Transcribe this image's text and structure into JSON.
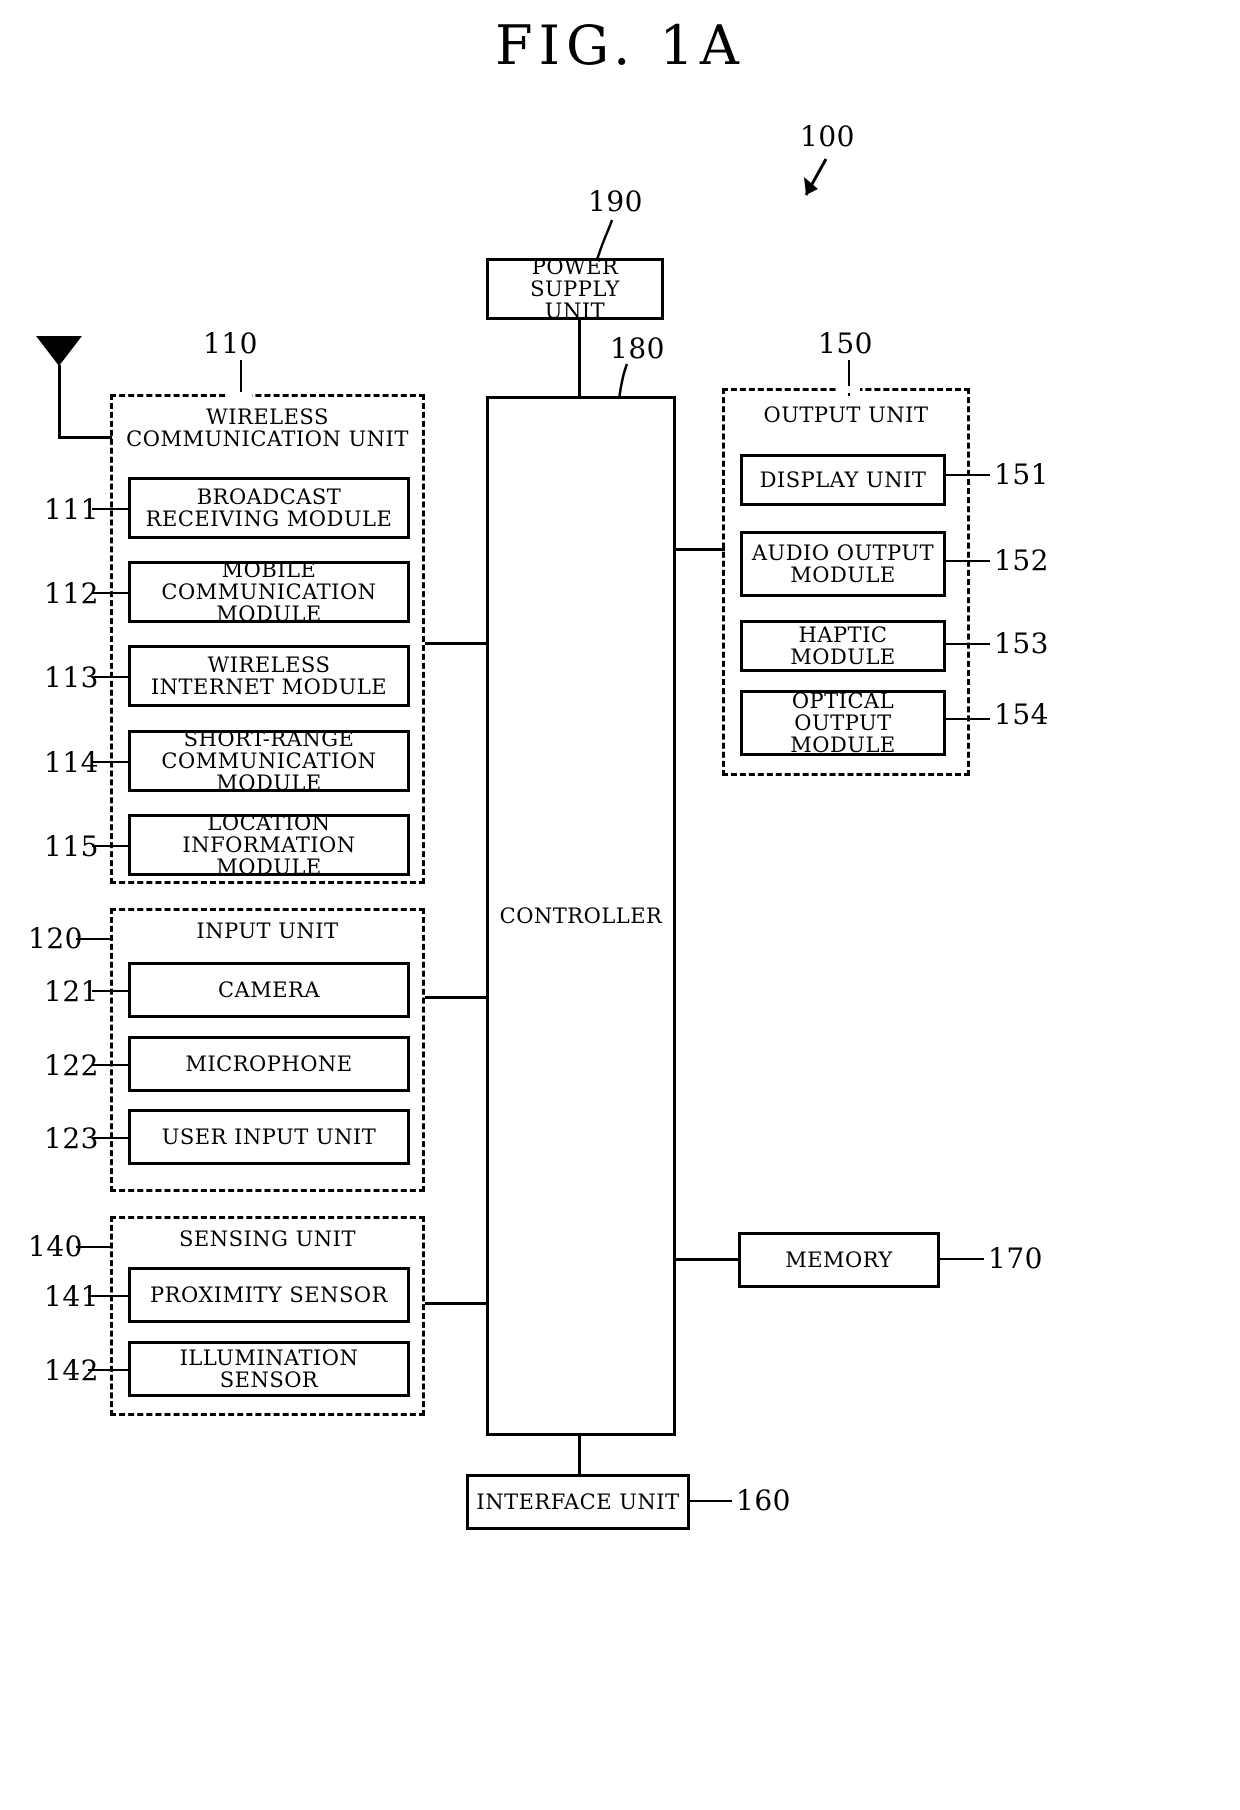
{
  "figure": {
    "title": "FIG.  1A",
    "device_ref": "100"
  },
  "blocks": {
    "power_supply": {
      "label": "POWER SUPPLY\nUNIT",
      "ref": "190"
    },
    "controller": {
      "label": "CONTROLLER",
      "ref": "180"
    },
    "memory": {
      "label": "MEMORY",
      "ref": "170"
    },
    "interface": {
      "label": "INTERFACE UNIT",
      "ref": "160"
    }
  },
  "groups": {
    "wireless_communication": {
      "title": "WIRELESS\nCOMMUNICATION UNIT",
      "ref": "110",
      "items": [
        {
          "ref": "111",
          "label": "BROADCAST\nRECEIVING MODULE"
        },
        {
          "ref": "112",
          "label": "MOBILE\nCOMMUNICATION MODULE"
        },
        {
          "ref": "113",
          "label": "WIRELESS\nINTERNET MODULE"
        },
        {
          "ref": "114",
          "label": "SHORT-RANGE\nCOMMUNICATION MODULE"
        },
        {
          "ref": "115",
          "label": "LOCATION\nINFORMATION MODULE"
        }
      ]
    },
    "input_unit": {
      "title": "INPUT UNIT",
      "ref": "120",
      "items": [
        {
          "ref": "121",
          "label": "CAMERA"
        },
        {
          "ref": "122",
          "label": "MICROPHONE"
        },
        {
          "ref": "123",
          "label": "USER INPUT UNIT"
        }
      ]
    },
    "sensing_unit": {
      "title": "SENSING UNIT",
      "ref": "140",
      "items": [
        {
          "ref": "141",
          "label": "PROXIMITY SENSOR"
        },
        {
          "ref": "142",
          "label": "ILLUMINATION SENSOR"
        }
      ]
    },
    "output_unit": {
      "title": "OUTPUT UNIT",
      "ref": "150",
      "items": [
        {
          "ref": "151",
          "label": "DISPLAY UNIT"
        },
        {
          "ref": "152",
          "label": "AUDIO OUTPUT\nMODULE"
        },
        {
          "ref": "153",
          "label": "HAPTIC MODULE"
        },
        {
          "ref": "154",
          "label": "OPTICAL OUTPUT\nMODULE"
        }
      ]
    }
  },
  "icons": {
    "antenna": "antenna-icon",
    "device_pointer": "arrow-pointer-icon"
  },
  "colors": {
    "ink": "#000000",
    "paper": "#ffffff"
  }
}
